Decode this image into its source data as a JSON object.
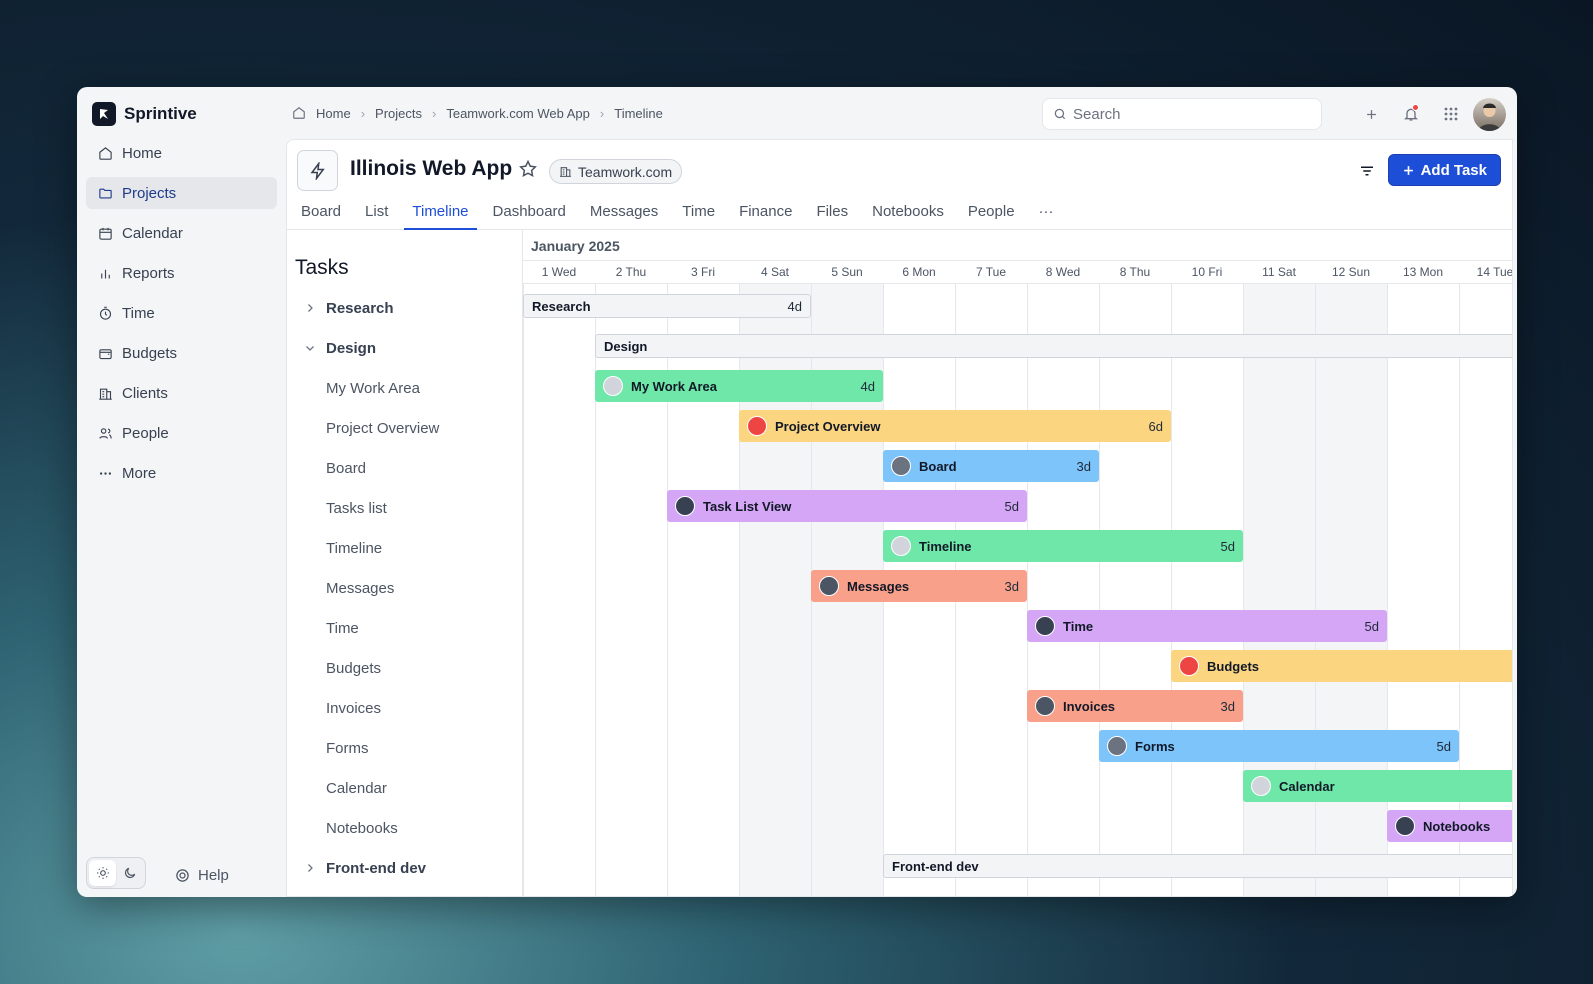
{
  "brand": {
    "name": "Sprintive"
  },
  "sidebar": {
    "items": [
      {
        "label": "Home",
        "icon": "home-icon"
      },
      {
        "label": "Projects",
        "icon": "folder-icon",
        "active": true
      },
      {
        "label": "Calendar",
        "icon": "calendar-icon"
      },
      {
        "label": "Reports",
        "icon": "bar-chart-icon"
      },
      {
        "label": "Time",
        "icon": "clock-icon"
      },
      {
        "label": "Budgets",
        "icon": "wallet-icon"
      },
      {
        "label": "Clients",
        "icon": "building-icon"
      },
      {
        "label": "People",
        "icon": "people-icon"
      },
      {
        "label": "More",
        "icon": "more-icon"
      }
    ],
    "help_label": "Help"
  },
  "breadcrumb": [
    "Home",
    "Projects",
    "Teamwork.com Web App",
    "Timeline"
  ],
  "search": {
    "placeholder": "Search"
  },
  "project": {
    "title": "Illinois Web App",
    "company": "Teamwork.com",
    "add_task_label": "Add Task"
  },
  "tabs": [
    "Board",
    "List",
    "Timeline",
    "Dashboard",
    "Messages",
    "Time",
    "Finance",
    "Files",
    "Notebooks",
    "People"
  ],
  "active_tab": "Timeline",
  "tasks_panel": {
    "title": "Tasks",
    "rows": [
      {
        "label": "Research",
        "group": true,
        "expanded": false
      },
      {
        "label": "Design",
        "group": true,
        "expanded": true
      },
      {
        "label": "My Work Area"
      },
      {
        "label": "Project Overview"
      },
      {
        "label": "Board"
      },
      {
        "label": "Tasks list"
      },
      {
        "label": "Timeline"
      },
      {
        "label": "Messages"
      },
      {
        "label": "Time"
      },
      {
        "label": "Budgets"
      },
      {
        "label": "Invoices"
      },
      {
        "label": "Forms"
      },
      {
        "label": "Calendar"
      },
      {
        "label": "Notebooks"
      },
      {
        "label": "Front-end dev",
        "group": true,
        "expanded": false
      }
    ]
  },
  "timeline": {
    "month": "January 2025",
    "days": [
      "1 Wed",
      "2 Thu",
      "3 Fri",
      "4 Sat",
      "5 Sun",
      "6 Mon",
      "7 Tue",
      "8 Wed",
      "8 Thu",
      "10 Fri",
      "11 Sat",
      "12 Sun",
      "13 Mon",
      "14 Tue"
    ],
    "weekend_days": [
      3,
      4,
      10,
      11
    ],
    "bars": [
      {
        "label": "Research",
        "start": 0,
        "span": 4,
        "duration": "4d",
        "group": true,
        "row": 0
      },
      {
        "label": "Design",
        "start": 1,
        "span": 14,
        "duration": "",
        "group": true,
        "row": 1
      },
      {
        "label": "My Work Area",
        "start": 1,
        "span": 4,
        "duration": "4d",
        "color": "#6ee7a8",
        "row": 2,
        "avatar": "#d1d5db"
      },
      {
        "label": "Project Overview",
        "start": 3,
        "span": 6,
        "duration": "6d",
        "color": "#fcd581",
        "row": 3,
        "avatar": "#ef4444"
      },
      {
        "label": "Board",
        "start": 5,
        "span": 3,
        "duration": "3d",
        "color": "#7cc4fa",
        "row": 4,
        "avatar": "#6b7280"
      },
      {
        "label": "Task List View",
        "start": 2,
        "span": 5,
        "duration": "5d",
        "color": "#d4a6f5",
        "row": 5,
        "avatar": "#374151"
      },
      {
        "label": "Timeline",
        "start": 5,
        "span": 5,
        "duration": "5d",
        "color": "#6ee7a8",
        "row": 6,
        "avatar": "#d1d5db"
      },
      {
        "label": "Messages",
        "start": 4,
        "span": 3,
        "duration": "3d",
        "color": "#f9a08b",
        "row": 7,
        "avatar": "#4b5563"
      },
      {
        "label": "Time",
        "start": 7,
        "span": 5,
        "duration": "5d",
        "color": "#d4a6f5",
        "row": 8,
        "avatar": "#374151"
      },
      {
        "label": "Budgets",
        "start": 9,
        "span": 5,
        "duration": "",
        "color": "#fcd581",
        "row": 9,
        "avatar": "#ef4444"
      },
      {
        "label": "Invoices",
        "start": 7,
        "span": 3,
        "duration": "3d",
        "color": "#f9a08b",
        "row": 10,
        "avatar": "#4b5563"
      },
      {
        "label": "Forms",
        "start": 8,
        "span": 5,
        "duration": "5d",
        "color": "#7cc4fa",
        "row": 11,
        "avatar": "#6b7280"
      },
      {
        "label": "Calendar",
        "start": 10,
        "span": 4,
        "duration": "",
        "color": "#6ee7a8",
        "row": 12,
        "avatar": "#d1d5db"
      },
      {
        "label": "Notebooks",
        "start": 12,
        "span": 2,
        "duration": "",
        "color": "#d4a6f5",
        "row": 13,
        "avatar": "#374151"
      },
      {
        "label": "Front-end dev",
        "start": 5,
        "span": 10,
        "duration": "",
        "group": true,
        "row": 14
      }
    ]
  },
  "colors": {
    "accent": "#1d4ed8",
    "notification": "#ef4444"
  }
}
